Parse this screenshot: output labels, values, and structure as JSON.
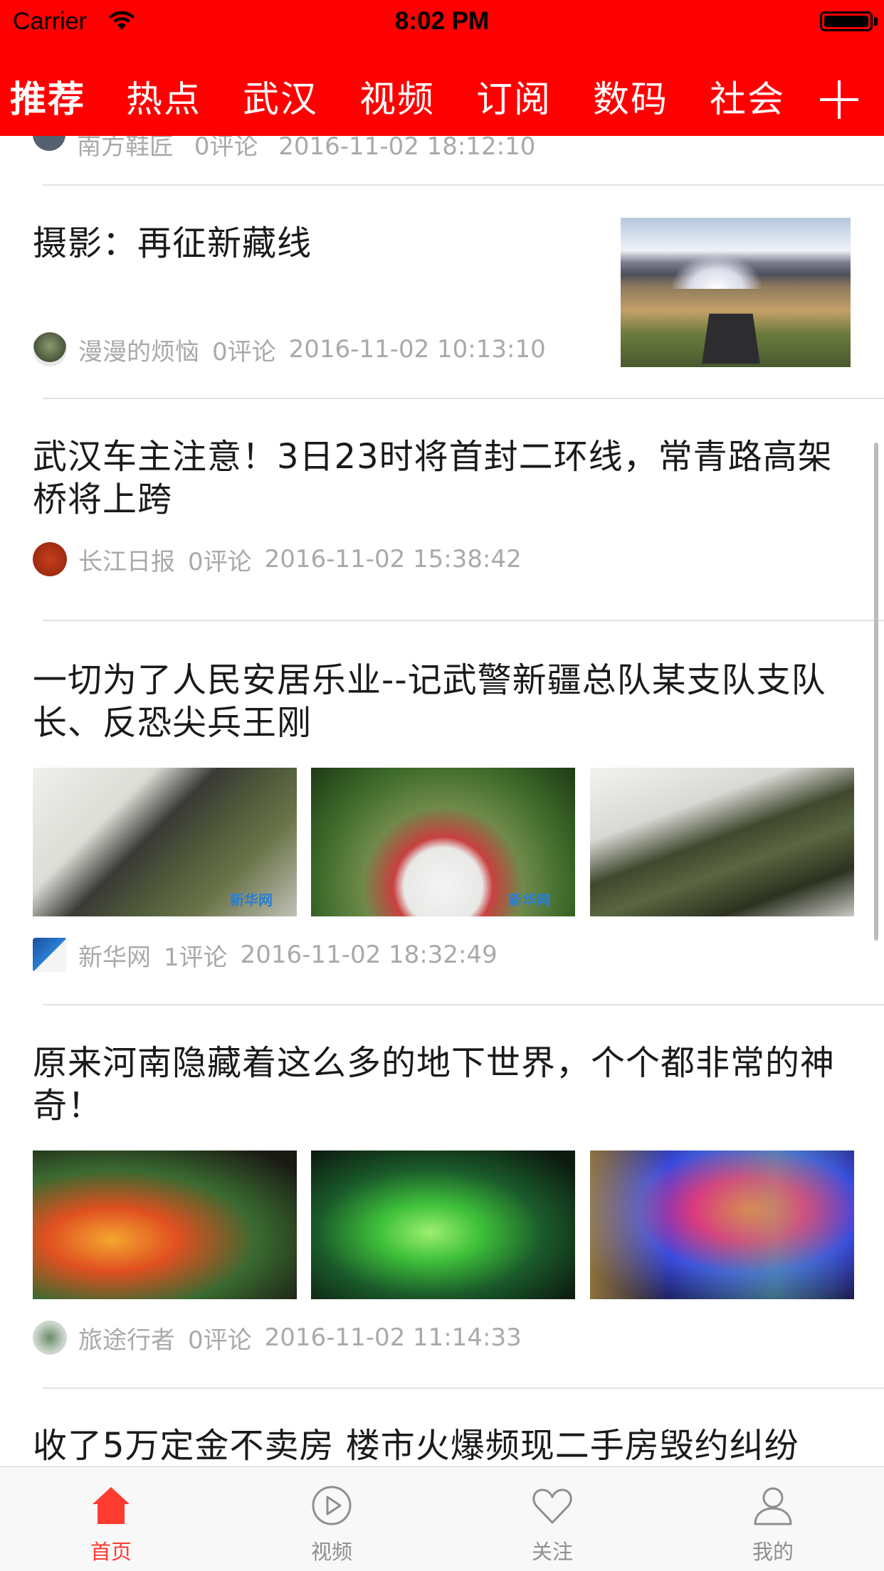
{
  "status_bar": {
    "carrier": "Carrier",
    "time": "8:02 PM"
  },
  "channel_tabs": [
    "推荐",
    "热点",
    "武汉",
    "视频",
    "订阅",
    "数码",
    "社会"
  ],
  "active_channel": "推荐",
  "colors": {
    "header_bg": "#fe0000",
    "tab_active": "#fe3b30",
    "meta_text": "#a9a9a9",
    "title_text": "#1a1a1a"
  },
  "feed": {
    "peek": {
      "source": "南方鞋匠",
      "comments": "0评论",
      "time": "2016-11-02 18:12:10"
    },
    "articles": [
      {
        "title": "摄影：再征新藏线",
        "source": "漫漫的烦恼",
        "comments": "0评论",
        "time": "2016-11-02 10:13:10"
      },
      {
        "title": "武汉车主注意！3日23时将首封二环线，常青路高架桥将上跨",
        "source": "长江日报",
        "comments": "0评论",
        "time": "2016-11-02 15:38:42"
      },
      {
        "title": "一切为了人民安居乐业--记武警新疆总队某支队支队长、反恐尖兵王刚",
        "source": "新华网",
        "comments": "1评论",
        "time": "2016-11-02 18:32:49"
      },
      {
        "title": "原来河南隐藏着这么多的地下世界，个个都非常的神奇！",
        "source": "旅途行者",
        "comments": "0评论",
        "time": "2016-11-02 11:14:33"
      },
      {
        "title": "收了5万定金不卖房 楼市火爆频现二手房毁约纠纷"
      }
    ]
  },
  "bottom_tabs": [
    {
      "label": "首页",
      "icon": "home-icon",
      "active": true
    },
    {
      "label": "视频",
      "icon": "play-icon",
      "active": false
    },
    {
      "label": "关注",
      "icon": "heart-icon",
      "active": false
    },
    {
      "label": "我的",
      "icon": "user-icon",
      "active": false
    }
  ]
}
